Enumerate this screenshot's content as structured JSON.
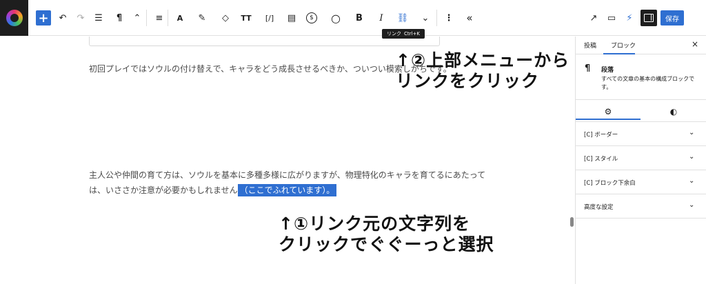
{
  "toolbar": {
    "add_label": "+",
    "undo_label": "↶",
    "redo_label": "↷",
    "outline_label": "☰",
    "paragraph_label": "¶",
    "move_label": "⌃",
    "align_label": "≡",
    "text_label": "A",
    "highlight_label": "✎",
    "tag_label": "◇",
    "transform_label": "TT",
    "shortcode_label": "[/]",
    "note_label": "▤",
    "dollar_label": "$",
    "circle_label": "○",
    "bold_label": "B",
    "italic_label": "I",
    "link_label": "⛓",
    "more_rich_label": "⌄",
    "options_label": "⋮",
    "collapse_label": "«",
    "view_label": "↗",
    "preview_label": "▭",
    "bolt_label": "⚡",
    "save_label": "保存"
  },
  "tooltip": {
    "label": "リンク",
    "shortcut": "Ctrl+K"
  },
  "editor": {
    "para1": "初回プレイではソウルの付け替えで、キャラをどう成長させるべきか、ついつい模索しがちです。",
    "para2_before": "主人公や仲間の育て方は、ソウルを基本に多種多様に広がりますが、物理特化のキャラを育てるにあたっては、いささか注意が必要かもしれません",
    "para2_selected": "（ここでふれています）。"
  },
  "annotations": {
    "step2_line1": "↑②上部メニューから",
    "step2_line2": "リンクをクリック",
    "step1_line1": "↑①リンク元の文字列を",
    "step1_line2": "クリックでぐぐーっと選択"
  },
  "sidebar": {
    "tab_post": "投稿",
    "tab_block": "ブロック",
    "close": "×",
    "block_icon": "¶",
    "block_title": "段落",
    "block_desc": "すべての文章の基本の構成ブロックです。",
    "settings_icon": "⚙",
    "styles_icon": "◐",
    "panels": [
      {
        "label": "[C] ボーダー"
      },
      {
        "label": "[C] スタイル"
      },
      {
        "label": "[C] ブロック下余白"
      },
      {
        "label": "高度な設定"
      }
    ]
  },
  "colors": {
    "accent": "#2f6fd1",
    "dark": "#1e1e1e"
  }
}
